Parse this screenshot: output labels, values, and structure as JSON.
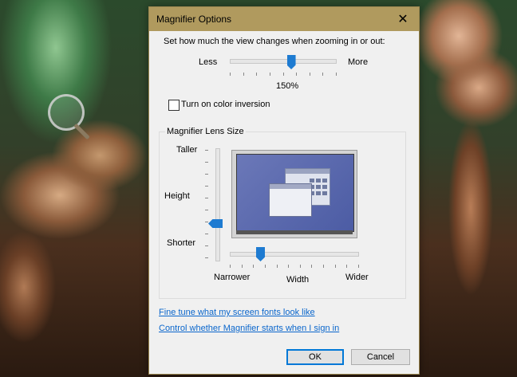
{
  "dialog": {
    "title": "Magnifier Options",
    "close_icon": "close-icon",
    "zoom": {
      "label": "Set how much the view changes when zooming in or out:",
      "less_label": "Less",
      "more_label": "More",
      "value_text": "150%",
      "level_fraction": 0.58
    },
    "color_inversion": {
      "label": "Turn on color inversion",
      "checked": false
    },
    "lens_size": {
      "group_title": "Magnifier Lens Size",
      "taller_label": "Taller",
      "height_label": "Height",
      "shorter_label": "Shorter",
      "narrower_label": "Narrower",
      "width_label": "Width",
      "wider_label": "Wider",
      "height_fraction": 0.25,
      "width_fraction": 0.24
    },
    "links": {
      "fine_tune": "Fine tune what my screen fonts look like",
      "control_startup": "Control whether Magnifier starts when I sign in"
    },
    "buttons": {
      "ok": "OK",
      "cancel": "Cancel"
    }
  },
  "colors": {
    "accent": "#1e7bd1",
    "titlebar": "#b09a5e",
    "link": "#0a66cc"
  }
}
